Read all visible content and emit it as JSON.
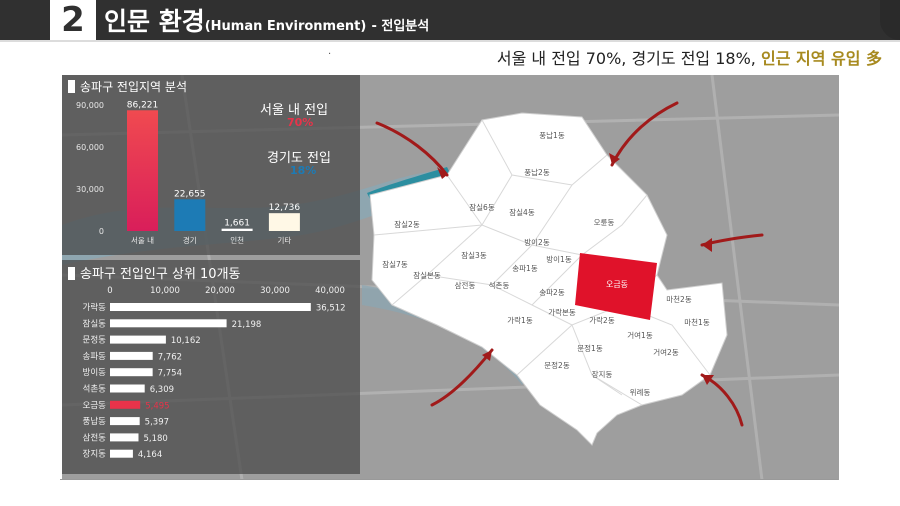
{
  "header": {
    "number": "2",
    "title": "인문 환경",
    "subtitle": "(Human Environment)",
    "section": "- 전입분석"
  },
  "headline": {
    "text": "서울 내 전입 70%, 경기도 전입 18%, ",
    "highlight": "인근 지역 유입 多"
  },
  "dot": ".",
  "panel1": {
    "title": "송파구 전입지역 분석",
    "seoul_label": "서울 내 전입",
    "seoul_pct": "70%",
    "gyeonggi_label": "경기도 전입",
    "gyeonggi_pct": "18%"
  },
  "panel2": {
    "title": "송파구 전입인구 상위 10개동"
  },
  "colors": {
    "accent_red": "#e8334a",
    "blue": "#1d7bb5",
    "gold": "#a78a1f"
  },
  "chart_data": [
    {
      "type": "bar",
      "title": "송파구 전입지역 분석",
      "categories": [
        "서울 내",
        "경기",
        "인천",
        "기타"
      ],
      "values": [
        86221,
        22655,
        1661,
        12736
      ],
      "value_labels": [
        "86,221",
        "22,655",
        "1,661",
        "12,736"
      ],
      "yticks": [
        "90,000",
        "60,000",
        "30,000",
        "0"
      ],
      "ylim": [
        0,
        90000
      ]
    },
    {
      "type": "bar",
      "orientation": "horizontal",
      "title": "송파구 전입인구 상위 10개동",
      "categories": [
        "가락동",
        "잠실동",
        "문정동",
        "송파동",
        "방이동",
        "석촌동",
        "오금동",
        "풍납동",
        "삼전동",
        "장지동"
      ],
      "values": [
        36512,
        21198,
        10162,
        7762,
        7754,
        6309,
        5495,
        5397,
        5180,
        4164
      ],
      "value_labels": [
        "36,512",
        "21,198",
        "10,162",
        "7,762",
        "7,754",
        "6,309",
        "5,495",
        "5,397",
        "5,180",
        "4,164"
      ],
      "highlight": "오금동",
      "xticks": [
        "0",
        "10,000",
        "20,000",
        "30,000",
        "40,000"
      ],
      "xlim": [
        0,
        40000
      ]
    }
  ],
  "map": {
    "districts": [
      "풍납1동",
      "풍납2동",
      "잠실6동",
      "잠실4동",
      "오륜동",
      "잠실2동",
      "방이2동",
      "잠실3동",
      "방이1동",
      "잠실7동",
      "잠실본동",
      "삼전동",
      "석촌동",
      "송파1동",
      "송파2동",
      "오금동",
      "마천2동",
      "마천1동",
      "가락1동",
      "가락본동",
      "가락2동",
      "문정1동",
      "거여1동",
      "거여2동",
      "문정2동",
      "장지동",
      "위례동"
    ],
    "highlight": "오금동"
  }
}
